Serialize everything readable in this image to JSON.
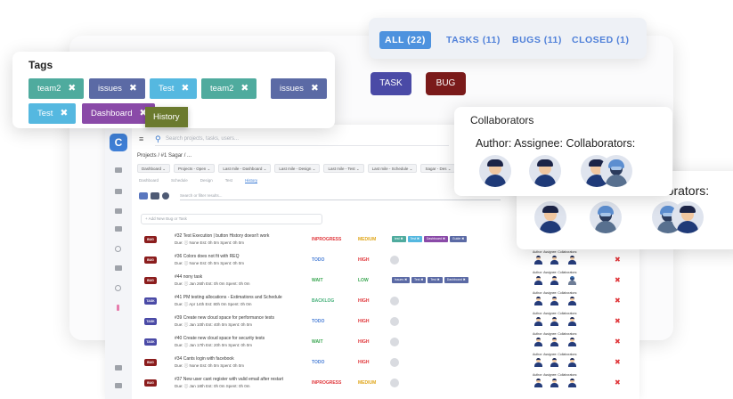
{
  "filter_tabs": [
    {
      "label": "ALL (22)",
      "active": true
    },
    {
      "label": "TASKS (11)",
      "active": false
    },
    {
      "label": "BUGS (11)",
      "active": false
    },
    {
      "label": "CLOSED (1)",
      "active": false
    }
  ],
  "tags_card": {
    "title": "Tags",
    "tags": [
      {
        "label": "team2",
        "color": "#4fab9e"
      },
      {
        "label": "issues",
        "color": "#5b6aa5"
      },
      {
        "label": "Test",
        "color": "#55b8e0"
      },
      {
        "label": "team2",
        "color": "#4fab9e"
      },
      {
        "label": "issues",
        "color": "#5b6aa5"
      },
      {
        "label": "Test",
        "color": "#55b8e0"
      },
      {
        "label": "Dashboard",
        "color": "#8a4aa8"
      }
    ],
    "history_tag": "History",
    "remove_glyph": "✖"
  },
  "type_buttons": {
    "task": "TASK",
    "bug": "BUG",
    "task_color": "#4a4aa6",
    "bug_color": "#7a1a1a"
  },
  "collaborators": {
    "title": "Collaborators",
    "roles": "Author: Assignee: Collaborators:",
    "roles_cut": "laborators:"
  },
  "app": {
    "logo": "C",
    "search_placeholder": "Search projects, tasks, users...",
    "breadcrumb": "Projects  /  #1 Sagar  /  ...",
    "filters": [
      "Dashboard",
      "Projects - Open",
      "Last mile - Dashboard",
      "Last mile - Design",
      "Last mile - Test",
      "Last mile - Schedule",
      "Sagar - Des"
    ],
    "subtabs": [
      "Dashboard",
      "Schedule",
      "Design",
      "Test",
      "History"
    ],
    "filter_placeholder": "Search or filter results...",
    "new_task_placeholder": "+ Add New Bug or Task",
    "collab_header": "Author: Assignee: Collaborators:",
    "delete_glyph": "✖"
  },
  "tasks": [
    {
      "type": "BUG",
      "title": "#32 Test Execution | button History doesn't work",
      "meta": "Due: ⓘ None  Est: 0h 0m  Spent: 0h 0m",
      "status": "INPROGRESS",
      "priority": "MEDIUM",
      "tags": [
        {
          "label": "test",
          "color": "#4fab9e"
        },
        {
          "label": "Test",
          "color": "#55b8e0"
        },
        {
          "label": "Dashboard",
          "color": "#8a4aa8"
        },
        {
          "label": "Guide",
          "color": "#5b6aa5"
        }
      ]
    },
    {
      "type": "BUG",
      "title": "#36 Colors does not fit with REQ",
      "meta": "Due: ⓘ None  Est: 0h 0m  Spent: 0h 0m",
      "status": "TODO",
      "priority": "HIGH",
      "tags": []
    },
    {
      "type": "BUG",
      "title": "#44 nony task",
      "meta": "Due: ⓘ Jan 26th  Est: 0h 0m  Spent: 0h 0m",
      "status": "WAIT",
      "priority": "LOW",
      "tags": [
        {
          "label": "Issues",
          "color": "#5b6aa5"
        },
        {
          "label": "Test",
          "color": "#5b6aa5"
        },
        {
          "label": "Test",
          "color": "#5b6aa5"
        },
        {
          "label": "Dashboard",
          "color": "#5b6aa5"
        }
      ]
    },
    {
      "type": "TASK",
      "title": "#41 PM testing allocations - Estimations and Schedule",
      "meta": "Due: ⓘ Apr 14th  Est: 80h 0m  Spent: 0h 0m",
      "status": "BACKLOG",
      "priority": "HIGH",
      "tags": []
    },
    {
      "type": "TASK",
      "title": "#39 Create new cloud space for performance tests",
      "meta": "Due: ⓘ Jan 10th  Est: 40h 0m  Spent: 0h 0m",
      "status": "TODO",
      "priority": "HIGH",
      "tags": []
    },
    {
      "type": "TASK",
      "title": "#40 Create new cloud space for security tests",
      "meta": "Due: ⓘ Jan 17th  Est: 20h 0m  Spent: 0h 0m",
      "status": "WAIT",
      "priority": "HIGH",
      "tags": []
    },
    {
      "type": "BUG",
      "title": "#34 Cants login with facebook",
      "meta": "Due: ⓘ None  Est: 0h 0m  Spent: 0h 0m",
      "status": "TODO",
      "priority": "HIGH",
      "tags": []
    },
    {
      "type": "BUG",
      "title": "#37 New user cant register with valid email after restart",
      "meta": "Due: ⓘ Jan 18th  Est: 0h 0m  Spent: 0h 0m",
      "status": "INPROGRESS",
      "priority": "MEDIUM",
      "tags": []
    }
  ],
  "colors": {
    "bug": "#8b1d1d",
    "task": "#4a4aa6",
    "status": {
      "INPROGRESS": "#e0373b",
      "TODO": "#4a7fd6",
      "WAIT": "#3aa651",
      "BACKLOG": "#46b07a"
    },
    "priority": {
      "MEDIUM": "#e0a61a",
      "HIGH": "#e0373b",
      "LOW": "#3aa651"
    }
  }
}
